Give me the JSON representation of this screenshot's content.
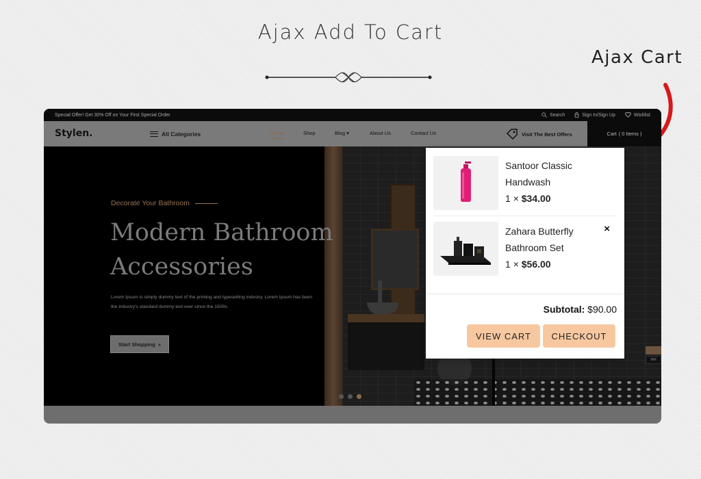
{
  "promo": {
    "title": "Ajax Add To Cart",
    "callout": "Ajax Cart"
  },
  "topbar": {
    "offer": "Special Offer! Get 30% Off on Your First Special Order",
    "search": "Search",
    "signin": "Sign In/Sign Up",
    "wishlist": "Wishlist"
  },
  "nav": {
    "logo": "Stylen.",
    "all_categories": "All Categories",
    "items": [
      "Home",
      "Shop",
      "Blog",
      "About Us",
      "Contact Us"
    ],
    "offers": "Visit The Best Offers",
    "cart": "Cart",
    "cart_count": "( 0 Items )"
  },
  "hero": {
    "kicker": "Decorate Your Bathroom",
    "title_line1": "Modern Bathroom",
    "title_line2": "Accessories",
    "text": "Lorem Ipsum is simply dummy text of the printing and typesetting industry. Lorem Ipsum has been the industry's standard dummy text ever since the 1500s.",
    "button": "Start Shopping",
    "slides": 3,
    "active_slide": 3,
    "side_chips": [
      "",
      "INR"
    ]
  },
  "cart": {
    "items": [
      {
        "name": "Santoor Classic Handwash",
        "qty": "1",
        "times": "×",
        "price": "$34.00",
        "icon": "pink-soap-dispenser"
      },
      {
        "name": "Zahara Butterfly Bathroom Set",
        "qty": "1",
        "times": "×",
        "price": "$56.00",
        "icon": "black-bathroom-set",
        "remove_icon": "×"
      }
    ],
    "subtotal_label": "Subtotal:",
    "subtotal_value": "$90.00",
    "view_cart": "VIEW CART",
    "checkout": "CHECKOUT"
  },
  "colors": {
    "accent_button": "#f7c8a0",
    "arrow": "#d61a1a",
    "hero_accent": "#9a7352"
  }
}
